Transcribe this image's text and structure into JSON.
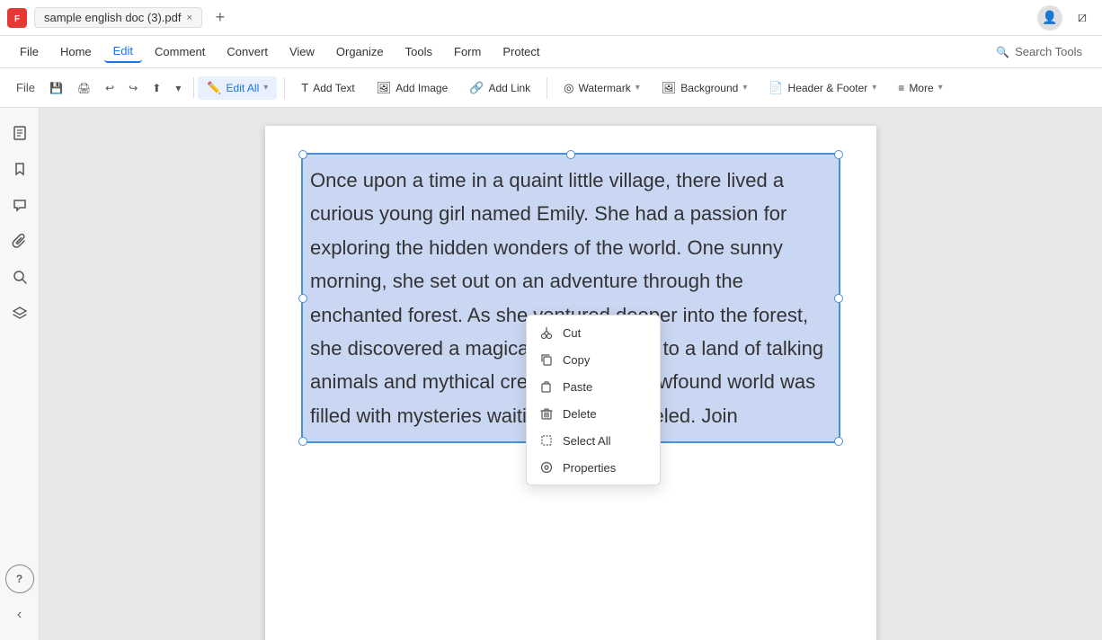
{
  "titlebar": {
    "app_icon": "F",
    "tab_name": "sample english doc (3).pdf",
    "tab_close": "×",
    "tab_add": "+"
  },
  "menubar": {
    "file": "File",
    "home": "Home",
    "edit": "Edit",
    "comment": "Comment",
    "convert": "Convert",
    "view": "View",
    "organize": "Organize",
    "tools": "Tools",
    "form": "Form",
    "protect": "Protect",
    "search_tools": "Search Tools"
  },
  "toolbar": {
    "edit_all": "Edit All",
    "add_text": "Add Text",
    "add_image": "Add Image",
    "add_link": "Add Link",
    "watermark": "Watermark",
    "background": "Background",
    "header_footer": "Header & Footer",
    "more": "More"
  },
  "sidebar": {
    "icons": [
      "☰",
      "🔖",
      "💬",
      "📎",
      "🔍",
      "◉"
    ],
    "bottom_icons": [
      "?",
      "‹"
    ]
  },
  "pdf": {
    "content": "Once upon a time in a quaint little village, there lived a curious young girl named Emily. She had a passion for exploring the hidden wonders of the world. One sunny morning, she set out on an adventure through the enchanted forest. As she ventured deeper into the forest, she discovered a magical portal leading to a land of talking animals and mythical creatures. This newfound world was filled with mysteries waiting to be unraveled. Join"
  },
  "context_menu": {
    "cut": "Cut",
    "copy": "Copy",
    "paste": "Paste",
    "delete": "Delete",
    "select_all": "Select All",
    "properties": "Properties"
  }
}
